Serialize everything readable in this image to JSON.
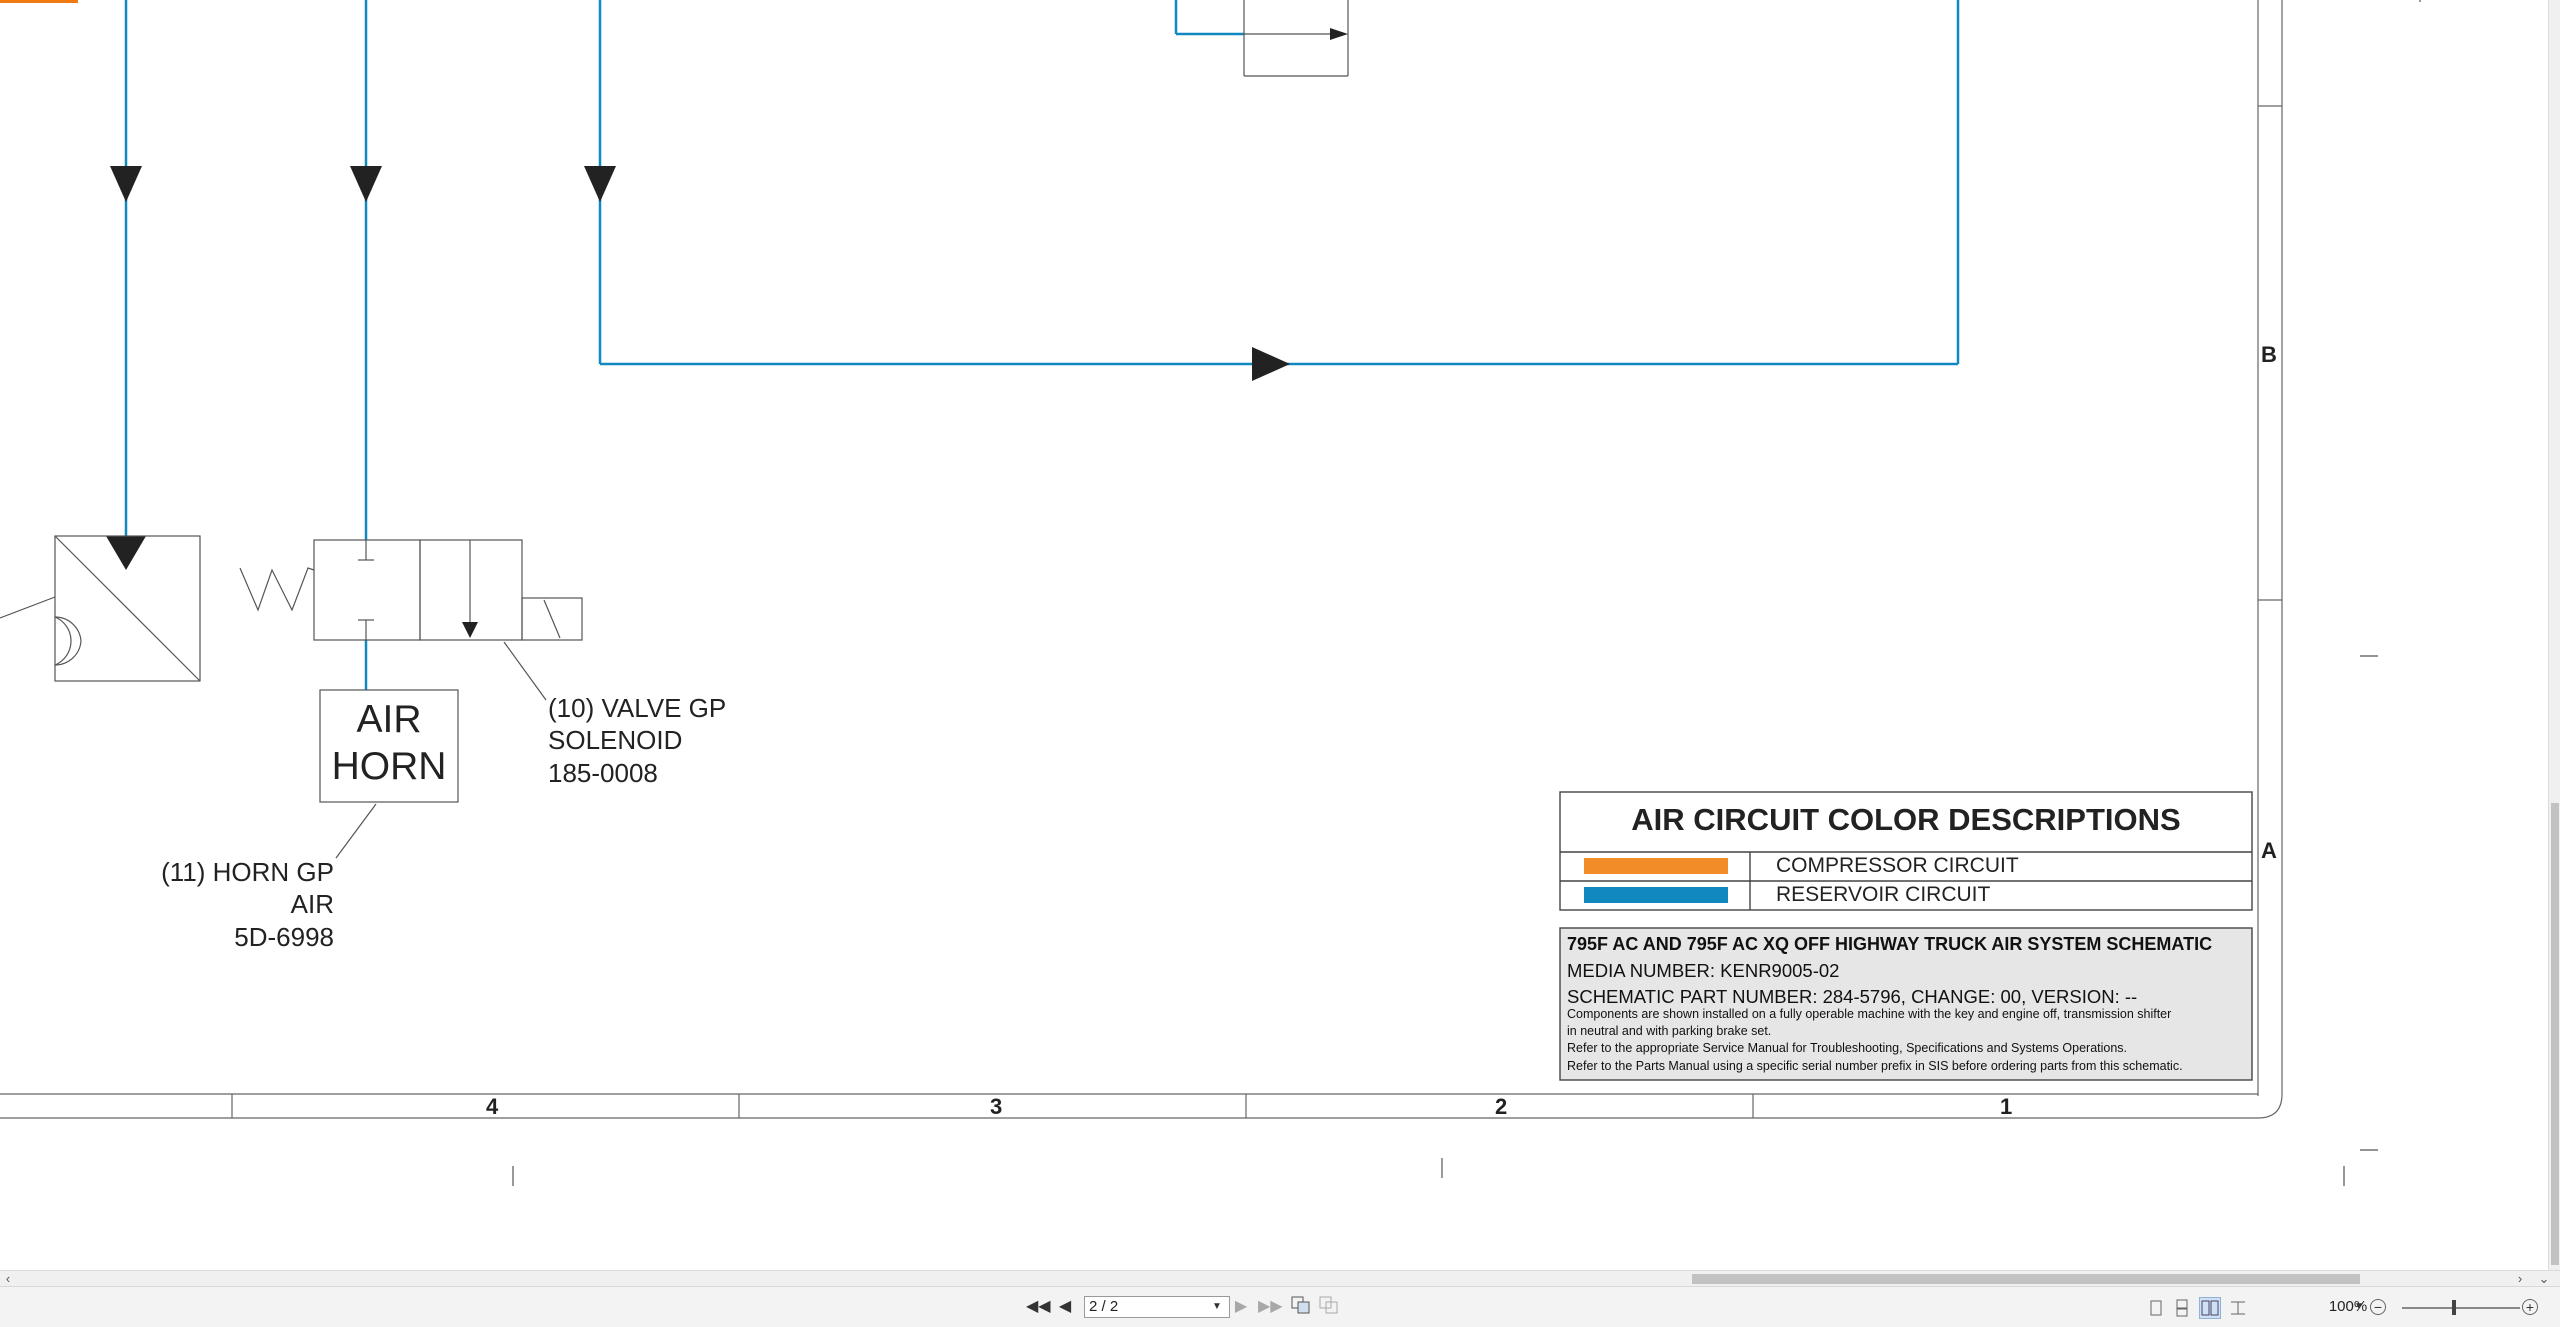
{
  "document": {
    "components": {
      "valve": {
        "qty": "(10) VALVE GP",
        "type": "SOLENOID",
        "part": "185-0008"
      },
      "horn_box": {
        "line1": "AIR",
        "line2": "HORN"
      },
      "horn": {
        "qty": "(11) HORN GP",
        "type": "AIR",
        "part": "5D-6998"
      }
    },
    "zones": {
      "b": "B",
      "a": "A"
    },
    "columns": {
      "c4": "4",
      "c3": "3",
      "c2": "2",
      "c1": "1"
    },
    "legend": {
      "title": "AIR CIRCUIT COLOR DESCRIPTIONS",
      "items": [
        {
          "label": "COMPRESSOR CIRCUIT",
          "color": "#f28c28"
        },
        {
          "label": "RESERVOIR CIRCUIT",
          "color": "#1188c0"
        }
      ]
    },
    "info": {
      "title": "795F AC AND 795F AC XQ OFF HIGHWAY TRUCK AIR SYSTEM SCHEMATIC",
      "media": "MEDIA NUMBER: KENR9005-02",
      "schematic": "SCHEMATIC PART NUMBER: 284-5796, CHANGE: 00, VERSION: --",
      "note1a": "Components are shown installed on a fully operable machine with the key and engine off, transmission shifter",
      "note1b": "in neutral and with parking brake set.",
      "note2": "Refer to the appropriate Service Manual for Troubleshooting, Specifications and Systems Operations.",
      "note3": "Refer to the Parts Manual using a specific serial number prefix in SIS before ordering parts from this schematic."
    },
    "colors": {
      "line_blue": "#1188c0",
      "accent_orange": "#f07a10"
    }
  },
  "statusbar": {
    "page_indicator": "2 / 2",
    "zoom": "100%"
  },
  "icons": [
    "first-page-icon",
    "prev-page-icon",
    "next-page-icon",
    "last-page-icon",
    "fit-page-icon",
    "fit-width-icon",
    "single-page-icon",
    "continuous-icon",
    "two-page-icon",
    "scroll-icon",
    "zoom-out-icon",
    "zoom-in-icon"
  ]
}
